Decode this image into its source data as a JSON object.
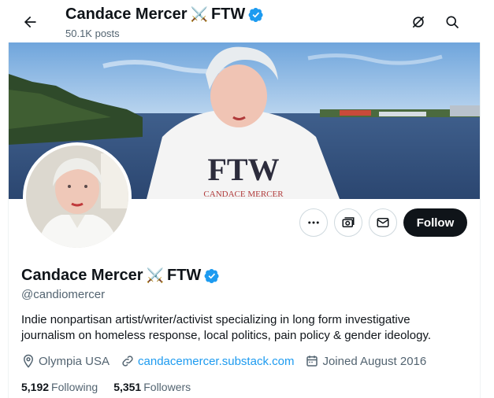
{
  "header": {
    "name": "Candace Mercer",
    "emoji": "⚔️",
    "suffix": "FTW",
    "posts": "50.1K posts"
  },
  "banner": {
    "shirt_text": "FTW",
    "shirt_subtext": "CANDACE MERCER"
  },
  "actions": {
    "follow_label": "Follow"
  },
  "profile": {
    "name": "Candace Mercer",
    "emoji": "⚔️",
    "suffix": "FTW",
    "handle": "@candiomercer",
    "bio": "Indie nonpartisan artist/writer/activist specializing in long form investigative journalism on homeless response, local politics, pain policy & gender ideology.",
    "location": "Olympia USA",
    "website": "candacemercer.substack.com",
    "joined": "Joined August 2016",
    "following_count": "5,192",
    "following_label": "Following",
    "followers_count": "5,351",
    "followers_label": "Followers"
  },
  "colors": {
    "accent": "#1d9bf0",
    "text": "#0f1419",
    "muted": "#536471",
    "button": "#0f1419"
  },
  "icons": [
    "back-arrow-icon",
    "grok-icon",
    "search-icon",
    "more-icon",
    "subscribe-icon",
    "message-icon",
    "verified-badge-icon",
    "location-icon",
    "link-icon",
    "calendar-icon"
  ]
}
